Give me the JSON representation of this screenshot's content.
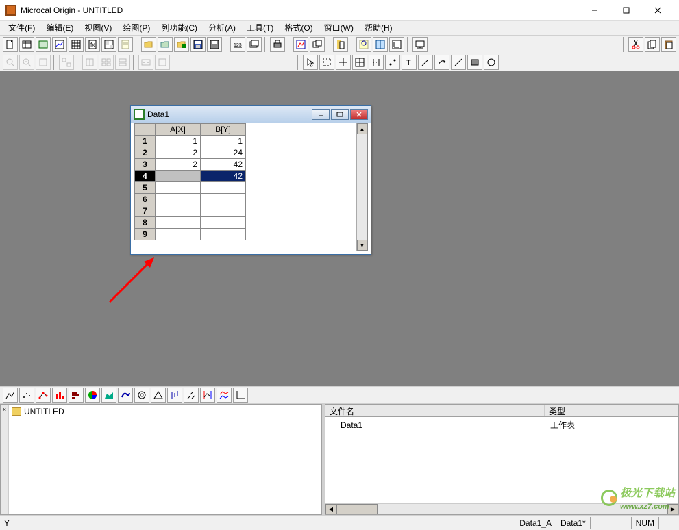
{
  "app": {
    "title": "Microcal Origin - UNTITLED"
  },
  "menus": [
    "文件(F)",
    "编辑(E)",
    "视图(V)",
    "绘图(P)",
    "列功能(C)",
    "分析(A)",
    "工具(T)",
    "格式(O)",
    "窗口(W)",
    "帮助(H)"
  ],
  "mdi": {
    "title": "Data1",
    "columns": [
      "A[X]",
      "B[Y]"
    ],
    "rows": [
      {
        "n": "1",
        "a": "1",
        "b": "1"
      },
      {
        "n": "2",
        "a": "2",
        "b": "24"
      },
      {
        "n": "3",
        "a": "2",
        "b": "42"
      },
      {
        "n": "4",
        "a": "",
        "b": "42",
        "selected": true
      },
      {
        "n": "5",
        "a": "",
        "b": ""
      },
      {
        "n": "6",
        "a": "",
        "b": ""
      },
      {
        "n": "7",
        "a": "",
        "b": ""
      },
      {
        "n": "8",
        "a": "",
        "b": ""
      },
      {
        "n": "9",
        "a": "",
        "b": ""
      }
    ]
  },
  "project_tree": {
    "root": "UNTITLED"
  },
  "file_list": {
    "headers": {
      "name": "文件名",
      "type": "类型"
    },
    "items": [
      {
        "name": "Data1",
        "type": "工作表"
      }
    ]
  },
  "status": {
    "left": "Y",
    "col": "Data1_A",
    "sheet": "Data1*",
    "num": "NUM"
  },
  "watermark": "极光下载站",
  "watermark_url": "www.xz7.com",
  "icons": {
    "new": "new",
    "open": "open",
    "save": "save",
    "print": "print",
    "cut": "cut",
    "copy": "copy",
    "paste": "paste"
  }
}
